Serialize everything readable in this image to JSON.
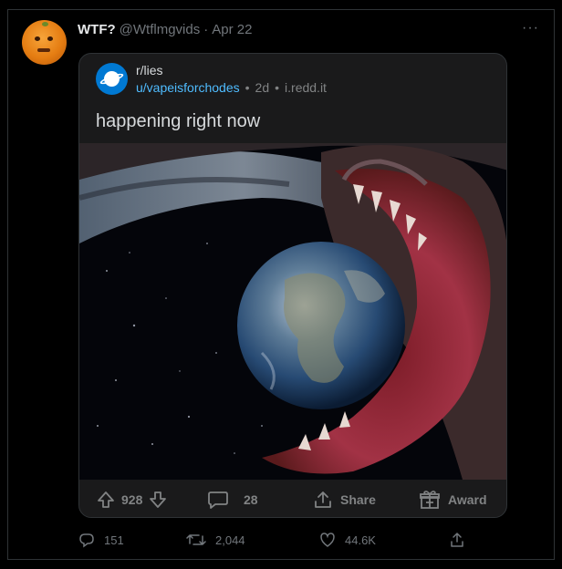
{
  "tweet": {
    "display_name": "WTF?",
    "handle": "@Wtflmgvids",
    "separator": "·",
    "date": "Apr 22",
    "more_label": "···"
  },
  "reddit_card": {
    "subreddit": "r/lies",
    "user": "u/vapeisforchodes",
    "dot1": "•",
    "age": "2d",
    "dot2": "•",
    "domain": "i.redd.it",
    "title": "happening right now",
    "upvotes": "928",
    "comments": "28",
    "share_label": "Share",
    "award_label": "Award",
    "accent_color": "#0079d3",
    "user_color": "#4fbcff"
  },
  "stats": {
    "replies": "151",
    "retweets": "2,044",
    "likes": "44.6K"
  },
  "icons": {
    "reply": "reply-icon",
    "retweet": "retweet-icon",
    "like": "heart-icon",
    "share": "share-icon",
    "upvote": "upvote-arrow-icon",
    "downvote": "downvote-arrow-icon",
    "comment": "comment-icon",
    "reddit_share": "share-icon",
    "award": "award-icon"
  }
}
